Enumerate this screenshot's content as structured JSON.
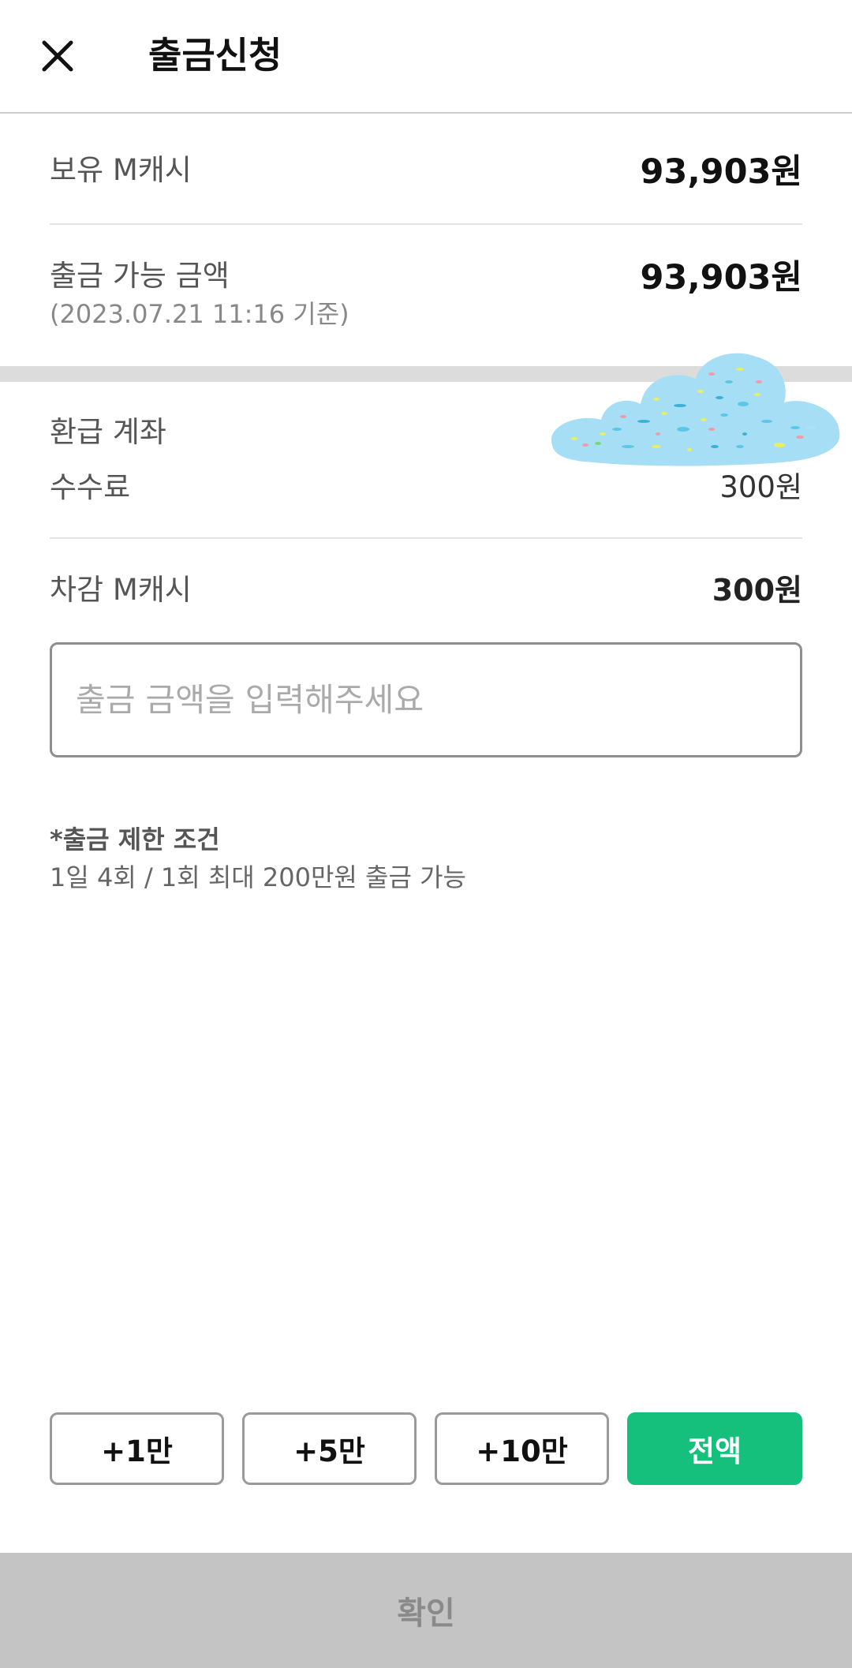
{
  "header": {
    "title": "출금신청"
  },
  "summary": {
    "held_label": "보유 M캐시",
    "held_value": "93,903원",
    "available_label": "출금 가능 금액",
    "available_date": "(2023.07.21 11:16 기준)",
    "available_value": "93,903원"
  },
  "refund": {
    "account_label": "환급 계좌",
    "fee_label": "수수료",
    "fee_value": "300원",
    "deduct_label": "차감 M캐시",
    "deduct_value": "300원"
  },
  "input": {
    "placeholder": "출금 금액을 입력해주세요",
    "value": ""
  },
  "limit_note": {
    "title": "*출금 제한 조건",
    "body": "1일 4회 / 1회 최대 200만원 출금 가능"
  },
  "quick_buttons": [
    {
      "label": "+1만"
    },
    {
      "label": "+5만"
    },
    {
      "label": "+10만"
    },
    {
      "label": "전액"
    }
  ],
  "confirm_label": "확인",
  "colors": {
    "accent": "#14c07c",
    "confirm_disabled_bg": "#c4c4c4",
    "section_divider": "#dcdcdc"
  },
  "icons": {
    "close": "close-icon",
    "overlay": "cloud-decoration"
  }
}
